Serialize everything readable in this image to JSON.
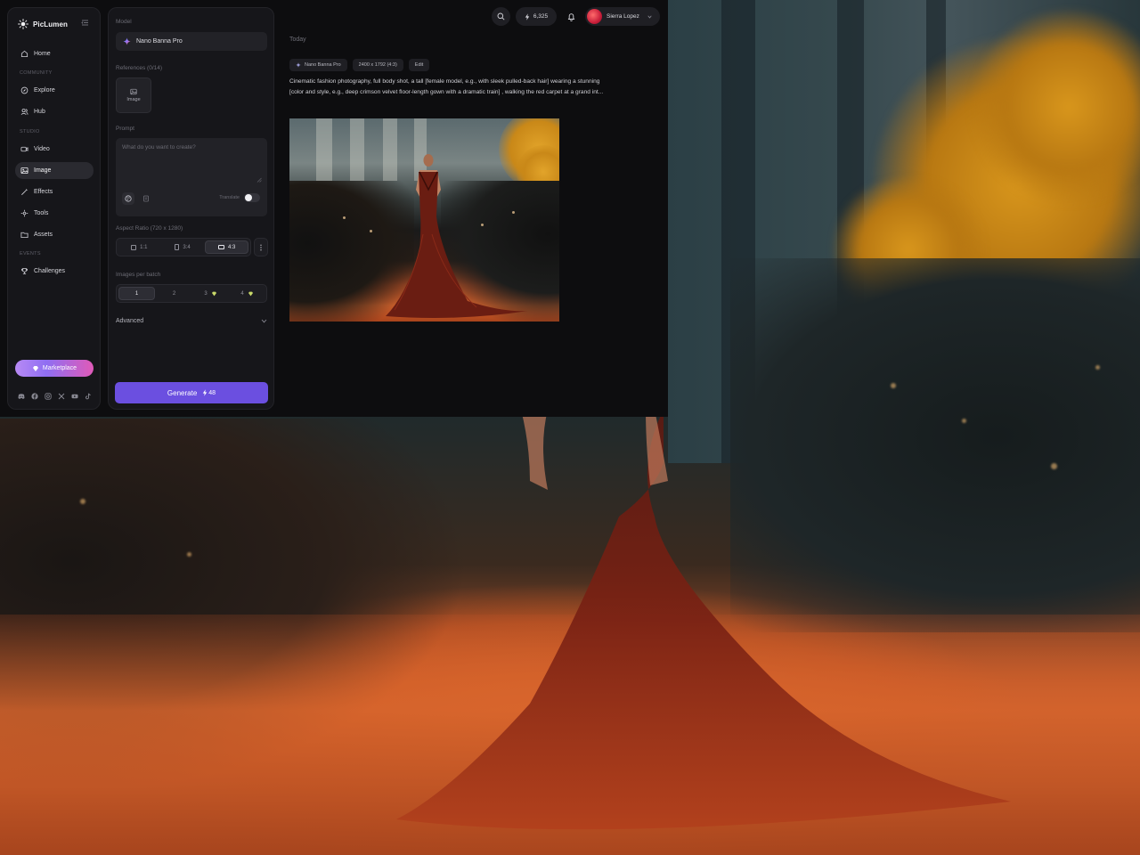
{
  "app": {
    "brand_name": "PicLumen"
  },
  "sidebar": {
    "sections": {
      "community": "COMMUNITY",
      "studio": "STUDIO",
      "events": "EVENTS"
    },
    "items": [
      {
        "label": "Home",
        "icon": "home-icon"
      },
      {
        "label": "Explore",
        "icon": "compass-icon"
      },
      {
        "label": "Hub",
        "icon": "users-icon"
      },
      {
        "label": "Video",
        "icon": "video-icon"
      },
      {
        "label": "Image",
        "icon": "image-icon",
        "active": true
      },
      {
        "label": "Effects",
        "icon": "magic-wand-icon"
      },
      {
        "label": "Tools",
        "icon": "tools-icon"
      },
      {
        "label": "Assets",
        "icon": "folder-icon"
      },
      {
        "label": "Challenges",
        "icon": "trophy-icon"
      }
    ],
    "marketplace_label": "Marketplace",
    "socials": [
      "discord-icon",
      "facebook-icon",
      "instagram-icon",
      "x-icon",
      "youtube-icon",
      "tiktok-icon"
    ]
  },
  "panel": {
    "model_label": "Model",
    "model_value": "Nano Banna Pro",
    "references_label": "References (0/14)",
    "reference_button": "Image",
    "prompt_label": "Prompt",
    "prompt_placeholder": "What do you want to create?",
    "translate_label": "Translate",
    "translate_enabled": false,
    "aspect_label": "Aspect Ratio (720 x 1280)",
    "aspect_options": [
      "1:1",
      "3:4",
      "4:3"
    ],
    "aspect_selected": "4:3",
    "batch_label": "Images per batch",
    "batch_options": [
      "1",
      "2",
      "3",
      "4"
    ],
    "batch_selected": "1",
    "advanced_label": "Advanced",
    "generate_label": "Generate",
    "generate_cost": "48"
  },
  "topbar": {
    "credits": "6,325",
    "user_name": "Sierra Lopez"
  },
  "feed": {
    "day_label": "Today",
    "tag_model": "Nano Banna Pro",
    "tag_size": "2400 x 1792 (4:3)",
    "tag_edit": "Edit",
    "prompt_line1": "Cinematic fashion photography, full body shot, a tall [female model, e.g., with sleek pulled-back hair] wearing a stunning",
    "prompt_line2": "[color and style, e.g., deep crimson velvet floor-length gown with a dramatic train] , walking the red carpet at a grand int..."
  },
  "colors": {
    "accent": "#6b4fe0",
    "panel_bg": "#16161a",
    "app_bg": "#0d0d0f"
  }
}
